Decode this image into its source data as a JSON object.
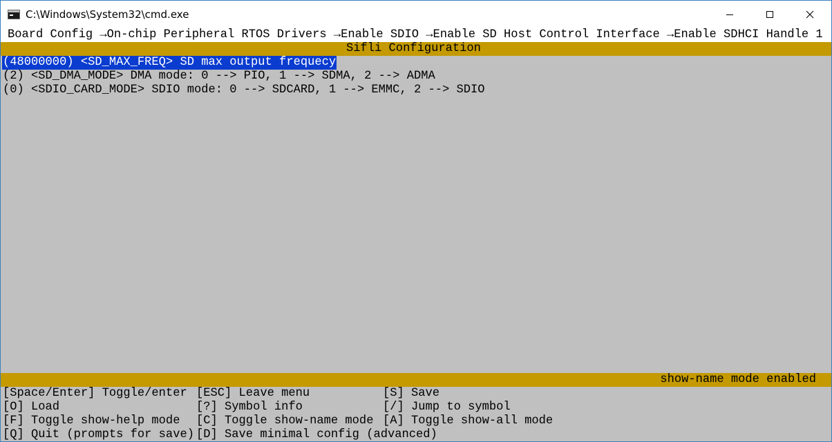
{
  "window": {
    "title": "C:\\Windows\\System32\\cmd.exe",
    "icon": "cmd-icon",
    "controls": {
      "minimize": "minimize-icon",
      "maximize": "maximize-icon",
      "close": "close-icon"
    }
  },
  "menuconfig": {
    "breadcrumb": "Board Config →On-chip Peripheral RTOS Drivers →Enable SDIO →Enable SD Host Control Interface →Enable SDHCI Handle 1",
    "title": "Sifli Configuration",
    "items": [
      {
        "text": "(48000000) <SD_MAX_FREQ> SD max output frequecy",
        "selected": true
      },
      {
        "text": "(2) <SD_DMA_MODE> DMA mode: 0 --> PIO, 1 --> SDMA, 2 --> ADMA",
        "selected": false
      },
      {
        "text": "(0) <SDIO_CARD_MODE> SDIO mode: 0 --> SDCARD, 1 --> EMMC, 2 --> SDIO",
        "selected": false
      }
    ],
    "status": "show-name mode enabled",
    "help": {
      "toggle_enter": "[Space/Enter] Toggle/enter",
      "leave_menu": "[ESC] Leave menu",
      "save": "[S] Save",
      "load": "[O] Load",
      "symbol_info": "[?] Symbol info",
      "jump": "[/] Jump to symbol",
      "show_help": "[F] Toggle show-help mode",
      "show_name": "[C] Toggle show-name mode",
      "show_all": "[A] Toggle show-all mode",
      "quit": "[Q] Quit (prompts for save)",
      "save_minimal": "[D] Save minimal config (advanced)"
    },
    "colors": {
      "background": "#c0c0c0",
      "bar": "#c49a00",
      "selection": "#0a3cd0"
    }
  }
}
